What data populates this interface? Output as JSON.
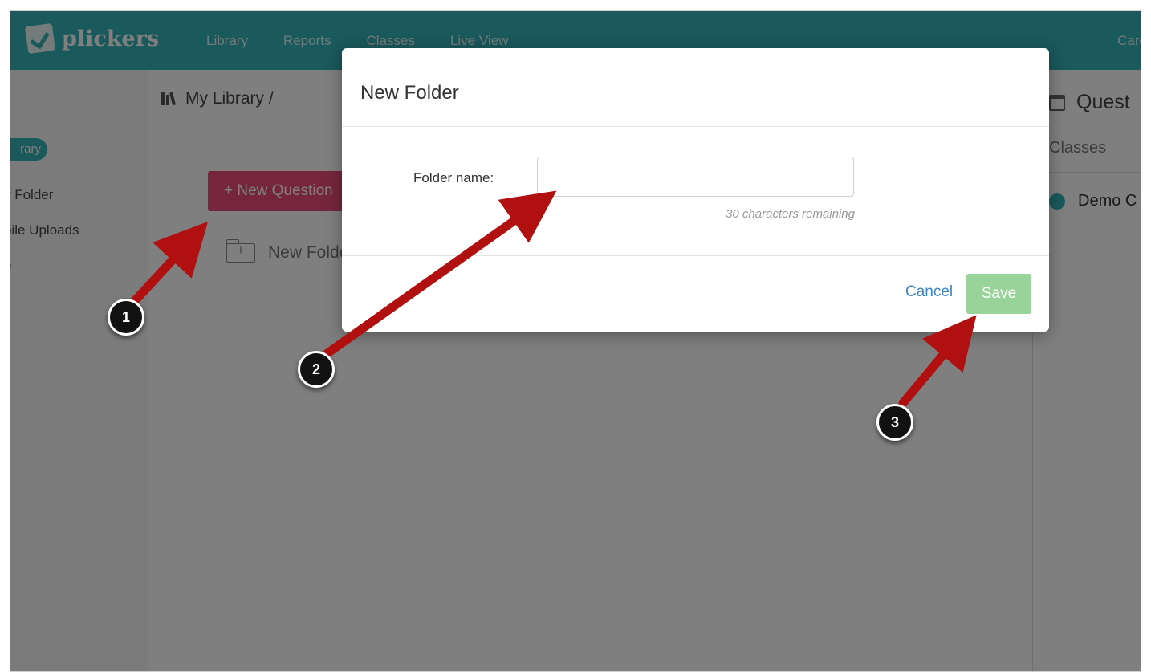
{
  "app": {
    "logo_text": "plickers",
    "nav": [
      "Library",
      "Reports",
      "Classes",
      "Live View"
    ],
    "user_name": "Caro"
  },
  "sidebar": {
    "items": [
      {
        "label": "rary",
        "active": true
      },
      {
        "label": "v Folder"
      },
      {
        "label": "bile Uploads"
      },
      {
        "label": "e"
      }
    ]
  },
  "library": {
    "breadcrumb": "My Library  /",
    "new_question_label": "+ New Question",
    "new_folder_label": "New Folde"
  },
  "right_panel": {
    "header": "Quest",
    "tab": "Classes",
    "class_name": "Demo C"
  },
  "modal": {
    "title": "New Folder",
    "field_label": "Folder name:",
    "field_value": "",
    "field_placeholder": "",
    "remaining": "30 characters remaining",
    "cancel_label": "Cancel",
    "save_label": "Save"
  },
  "annotations": {
    "steps": [
      "1",
      "2",
      "3"
    ],
    "arrow_color": "#b01010"
  },
  "colors": {
    "brand": "#34b3b8",
    "new_question": "#ea4c78",
    "save": "#98d49a",
    "link": "#3a85c6"
  }
}
